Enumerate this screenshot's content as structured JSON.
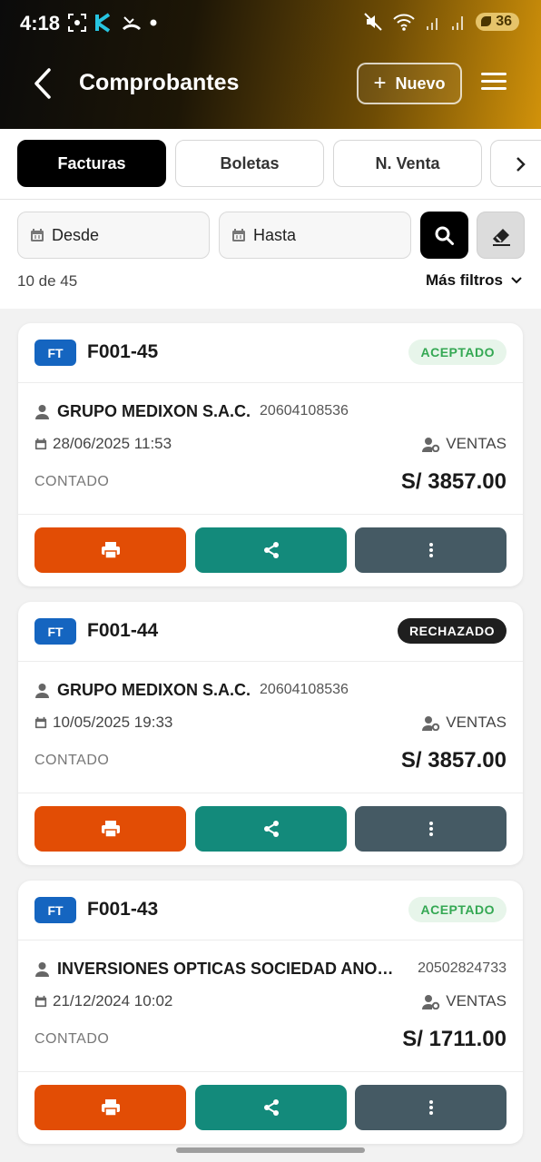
{
  "status_bar": {
    "time": "4:18",
    "battery": "36"
  },
  "header": {
    "title": "Comprobantes",
    "new_label": "Nuevo"
  },
  "tabs": [
    {
      "label": "Facturas",
      "active": true
    },
    {
      "label": "Boletas",
      "active": false
    },
    {
      "label": "N. Venta",
      "active": false
    }
  ],
  "filters": {
    "from_label": "Desde",
    "to_label": "Hasta",
    "count_text": "10 de 45",
    "more_filters_label": "Más filtros"
  },
  "documents": [
    {
      "type": "FT",
      "number": "F001-45",
      "status": "ACEPTADO",
      "status_kind": "ok",
      "customer": "GRUPO MEDIXON S.A.C.",
      "ruc": "20604108536",
      "datetime": "28/06/2025 11:53",
      "seller": "VENTAS",
      "payment": "CONTADO",
      "amount": "S/ 3857.00"
    },
    {
      "type": "FT",
      "number": "F001-44",
      "status": "RECHAZADO",
      "status_kind": "bad",
      "customer": "GRUPO MEDIXON S.A.C.",
      "ruc": "20604108536",
      "datetime": "10/05/2025 19:33",
      "seller": "VENTAS",
      "payment": "CONTADO",
      "amount": "S/ 3857.00"
    },
    {
      "type": "FT",
      "number": "F001-43",
      "status": "ACEPTADO",
      "status_kind": "ok",
      "customer": "INVERSIONES OPTICAS SOCIEDAD ANONIMA CERRADA",
      "ruc": "20502824733",
      "datetime": "21/12/2024 10:02",
      "seller": "VENTAS",
      "payment": "CONTADO",
      "amount": "S/ 1711.00"
    }
  ],
  "colors": {
    "print": "#e24d05",
    "share": "#138a7b",
    "more": "#455a64",
    "accent_badge": "#1565c0"
  }
}
